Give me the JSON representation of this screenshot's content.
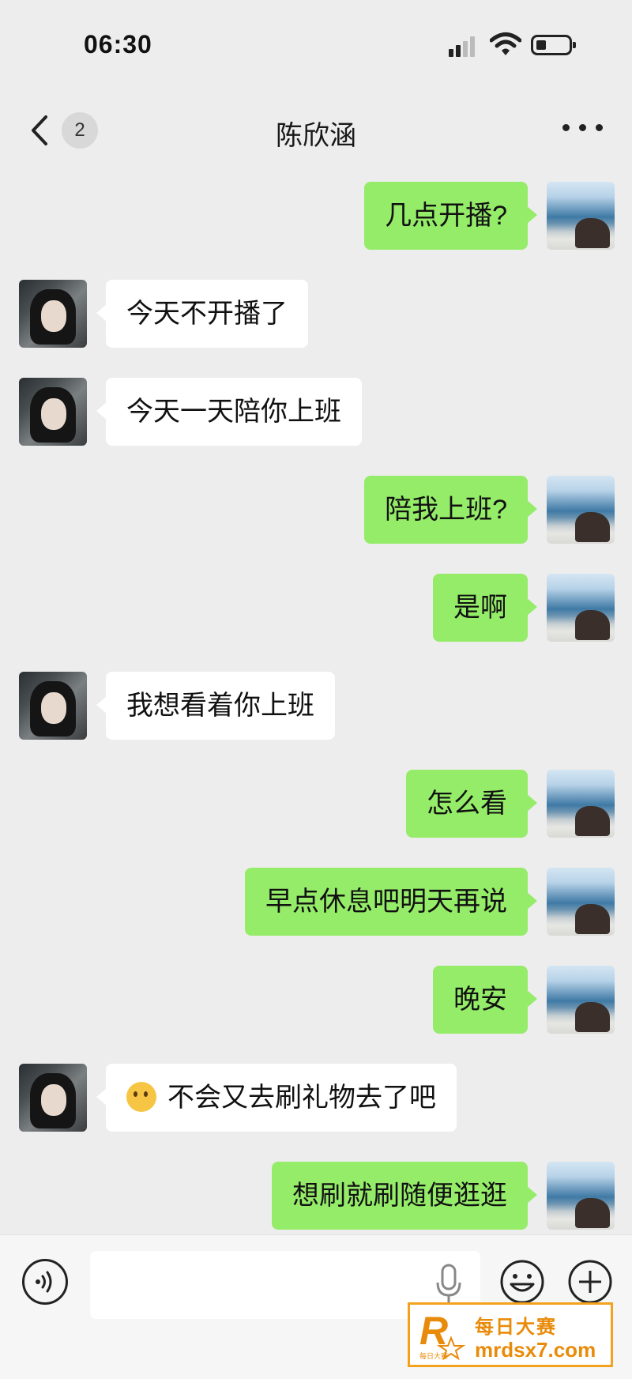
{
  "status_bar": {
    "time": "06:30"
  },
  "header": {
    "unread_count": "2",
    "title": "陈欣涵"
  },
  "messages": [
    {
      "from": "me",
      "text": "几点开播?"
    },
    {
      "from": "her",
      "text": "今天不开播了"
    },
    {
      "from": "her",
      "text": "今天一天陪你上班"
    },
    {
      "from": "me",
      "text": "陪我上班?"
    },
    {
      "from": "me",
      "text": "是啊"
    },
    {
      "from": "her",
      "text": "我想看着你上班"
    },
    {
      "from": "me",
      "text": "怎么看"
    },
    {
      "from": "me",
      "text": "早点休息吧明天再说"
    },
    {
      "from": "me",
      "text": "晚安"
    },
    {
      "from": "her",
      "emoji": "thinking-face-emoji",
      "text": "不会又去刷礼物去了吧"
    },
    {
      "from": "me",
      "text": "想刷就刷随便逛逛"
    }
  ],
  "input_bar": {
    "text_value": ""
  },
  "watermark": {
    "line1": "每日大赛",
    "line2": "mrdsx7.com",
    "logo_letter": "R",
    "logo_small": "每日大赛"
  },
  "colors": {
    "background": "#ededed",
    "my_bubble": "#95ec69",
    "her_bubble": "#ffffff",
    "watermark_accent": "#e98b0a"
  }
}
